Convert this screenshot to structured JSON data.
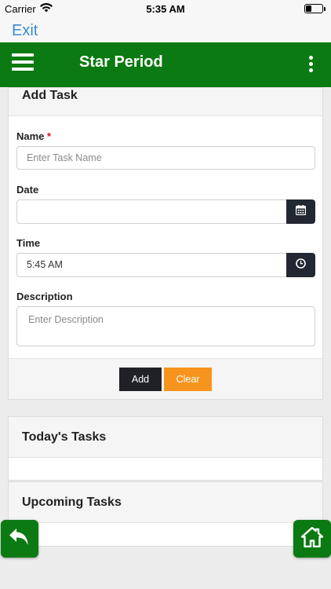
{
  "status_bar": {
    "carrier": "Carrier",
    "time": "5:35 AM"
  },
  "nav": {
    "exit_label": "Exit"
  },
  "header": {
    "title": "Star Period"
  },
  "add_task": {
    "title": "Add Task",
    "name_label": "Name",
    "required_mark": "*",
    "name_placeholder": "Enter Task Name",
    "date_label": "Date",
    "date_value": "",
    "time_label": "Time",
    "time_value": "5:45 AM",
    "description_label": "Description",
    "description_placeholder": "Enter Description",
    "add_button": "Add",
    "clear_button": "Clear"
  },
  "sections": {
    "today_title": "Today's Tasks",
    "upcoming_title": "Upcoming Tasks"
  },
  "colors": {
    "brand_green": "#0b7a12",
    "link_blue": "#3b8bd4",
    "dark_button": "#1f2127",
    "orange_button": "#f7941d"
  },
  "icons": [
    "wifi-icon",
    "battery-icon",
    "menu-icon",
    "more-vertical-icon",
    "calendar-icon",
    "clock-icon",
    "back-arrow-icon",
    "home-icon"
  ]
}
